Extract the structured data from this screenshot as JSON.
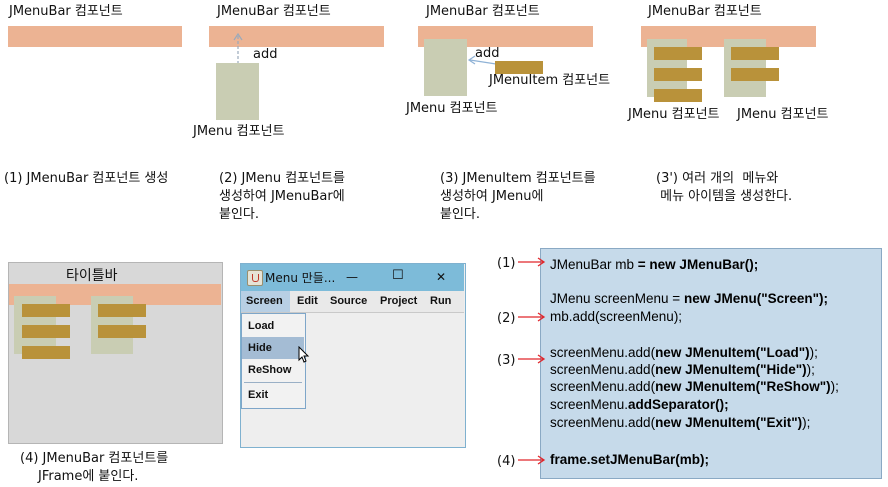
{
  "steps": {
    "s1": {
      "bar_label": "JMenuBar 컴포넌트",
      "caption": [
        "(1) JMenuBar 컴포넌트 생성"
      ]
    },
    "s2": {
      "bar_label": "JMenuBar 컴포넌트",
      "add": "add",
      "menu_label": "JMenu 컴포넌트",
      "caption": [
        "(2) JMenu 컴포넌트를",
        "생성하여 JMenuBar에",
        "붙인다."
      ]
    },
    "s3": {
      "bar_label": "JMenuBar 컴포넌트",
      "add": "add",
      "item_label": "JMenuItem 컴포넌트",
      "menu_label": "JMenu 컴포넌트",
      "caption": [
        "(3) JMenuItem 컴포넌트를",
        "생성하여 JMenu에",
        "붙인다."
      ]
    },
    "s3b": {
      "bar_label": "JMenuBar 컴포넌트",
      "menu_label_1": "JMenu 컴포넌트",
      "menu_label_2": "JMenu 컴포넌트",
      "caption": [
        "(3') 여러 개의  메뉴와",
        " 메뉴 아이템을 생성한다."
      ]
    },
    "s4": {
      "frame_title": "타이틀바",
      "caption": [
        "(4) JMenuBar 컴포넌트를",
        "JFrame에 붙인다."
      ]
    }
  },
  "window": {
    "title": "Menu 만들...",
    "controls": {
      "minimize": "—",
      "maximize": "☐",
      "close": "✕"
    },
    "menus": [
      "Screen",
      "Edit",
      "Source",
      "Project",
      "Run"
    ],
    "items": [
      "Load",
      "Hide",
      "ReShow",
      "Exit"
    ],
    "highlighted_item": "Hide"
  },
  "code": {
    "labels": [
      "(1)",
      "(2)",
      "(3)",
      "(4)"
    ],
    "lines": [
      {
        "n": "JMenuBar mb ",
        "b": "= new JMenuBar();"
      },
      {
        "n": "JMenu screenMenu = ",
        "b": "new JMenu(\"Screen\");"
      },
      {
        "n": "mb.add(screenMenu);",
        "b": ""
      },
      {
        "n": "screenMenu.add(",
        "b": "new JMenuItem(\"Load\")",
        "t": ");"
      },
      {
        "n": "screenMenu.add(",
        "b": "new JMenuItem(\"Hide\")",
        "t": ");"
      },
      {
        "n": "screenMenu.add(",
        "b": "new JMenuItem(\"ReShow\")",
        "t": ");"
      },
      {
        "n": "screenMenu.",
        "b": "addSeparator();",
        "t": ""
      },
      {
        "n": "screenMenu.add(",
        "b": "new JMenuItem(\"Exit\")",
        "t": ");"
      },
      {
        "n": "",
        "b": "frame.setJMenuBar(mb);",
        "t": ""
      }
    ]
  },
  "colors": {
    "menubar": "#ecb393",
    "menu": "#c9cdb3",
    "menuitem": "#b9923a",
    "code_bg": "#c6daea",
    "arrow": "#e0262b"
  }
}
